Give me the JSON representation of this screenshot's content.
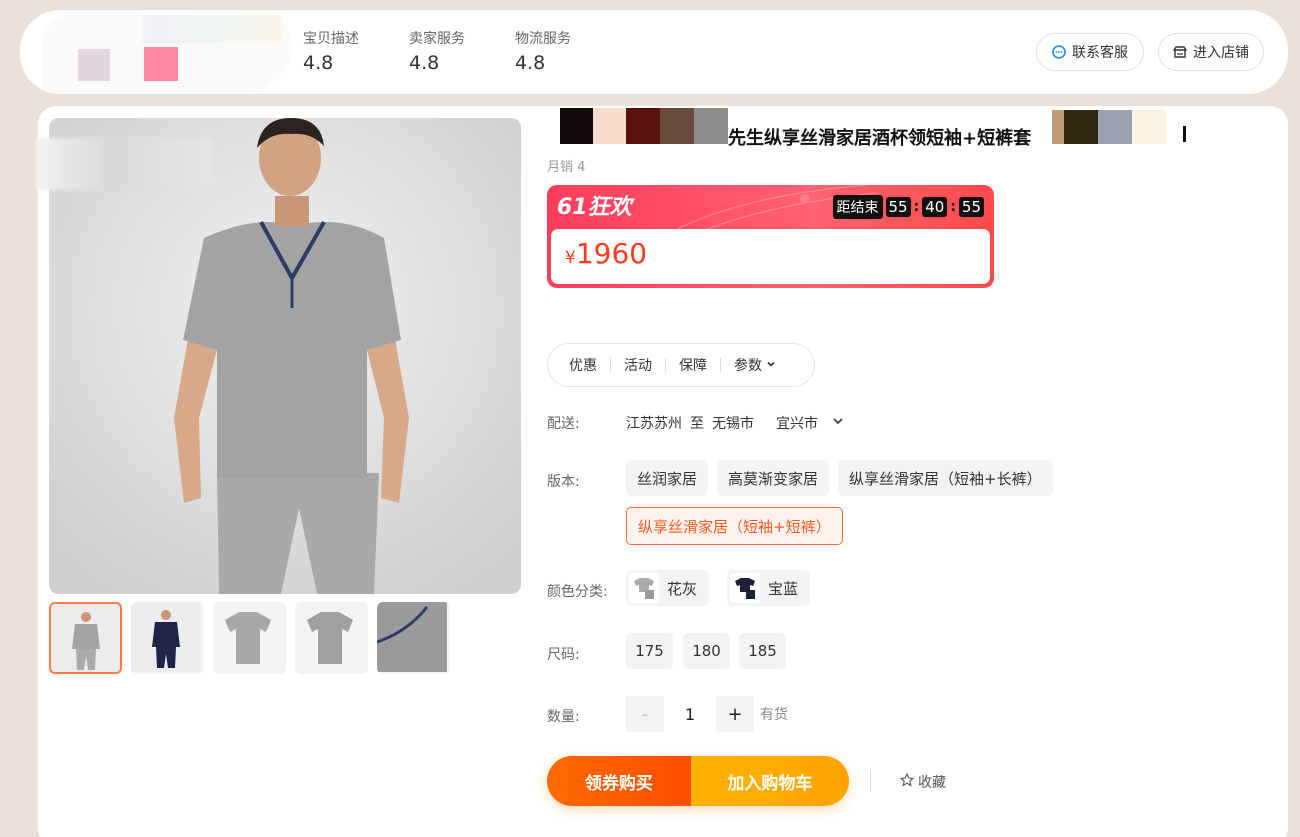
{
  "header": {
    "scores": [
      {
        "label": "宝贝描述",
        "value": "4.8"
      },
      {
        "label": "卖家服务",
        "value": "4.8"
      },
      {
        "label": "物流服务",
        "value": "4.8"
      }
    ],
    "contact_label": "联系客服",
    "store_label": "进入店铺"
  },
  "product": {
    "title_visible": "先生纵享丝滑家居酒杯领短袖+短裤套",
    "sales": "月销 4",
    "promo_name": "61狂欢",
    "countdown_label": "距结束",
    "countdown": {
      "h": "55",
      "m": "40",
      "s": "55"
    },
    "currency": "¥",
    "price": "1960",
    "tabs": [
      "优惠",
      "活动",
      "保障",
      "参数"
    ],
    "delivery": {
      "label": "配送:",
      "from": "江苏苏州",
      "to_word": "至",
      "city": "无锡市",
      "district": "宜兴市"
    },
    "version": {
      "label": "版本:",
      "options": [
        "丝润家居",
        "高莫渐变家居",
        "纵享丝滑家居（短袖+长裤）",
        "纵享丝滑家居（短袖+短裤）"
      ],
      "selected_index": 3
    },
    "color": {
      "label": "颜色分类:",
      "options": [
        "花灰",
        "宝蓝"
      ]
    },
    "size": {
      "label": "尺码:",
      "options": [
        "175",
        "180",
        "185"
      ]
    },
    "quantity": {
      "label": "数量:",
      "minus": "-",
      "value": "1",
      "plus": "+",
      "stock": "有货"
    },
    "buttons": {
      "coupon_buy": "领券购买",
      "add_cart": "加入购物车",
      "favorite": "收藏"
    }
  },
  "colors": {
    "accent": "#ff5a1f",
    "promo_red": "#ff3b5c",
    "buy_orange": "#ff6a00",
    "cart_yellow": "#ffb400"
  }
}
